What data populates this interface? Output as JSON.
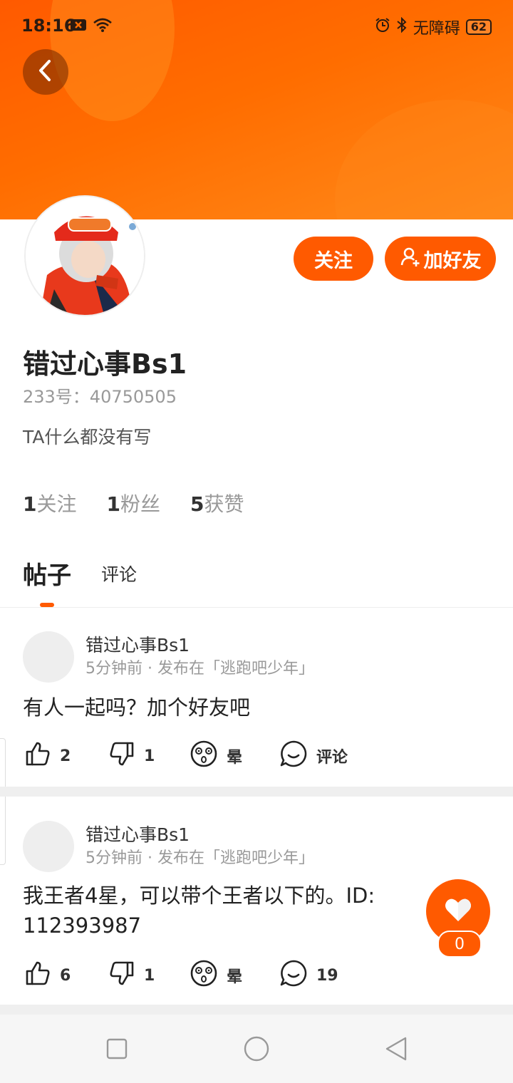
{
  "status_bar": {
    "time": "18:16",
    "accessibility": "无障碍",
    "battery": "62",
    "icons": [
      "notification-x-icon",
      "wifi-icon",
      "alarm-icon",
      "bluetooth-icon"
    ]
  },
  "header": {
    "back_icon": "chevron-left-icon"
  },
  "profile": {
    "username": "错过心事Bs1",
    "id_label": "233号：40750505",
    "bio": "TA什么都没有写",
    "follow_button": "关注",
    "add_friend_button": "加好友",
    "stats": [
      {
        "num": "1",
        "label": "关注"
      },
      {
        "num": "1",
        "label": "粉丝"
      },
      {
        "num": "5",
        "label": "获赞"
      }
    ]
  },
  "tabs": [
    {
      "label": "帖子",
      "active": true
    },
    {
      "label": "评论",
      "active": false
    }
  ],
  "posts": [
    {
      "author": "错过心事Bs1",
      "meta": "5分钟前 · 发布在「逃跑吧少年」",
      "content": "有人一起吗？加个好友吧",
      "likes": "2",
      "dislikes": "1",
      "dizzy": "晕",
      "comments": "评论"
    },
    {
      "author": "错过心事Bs1",
      "meta": "5分钟前 · 发布在「逃跑吧少年」",
      "content": "我王者4星，可以带个王者以下的。ID: 112393987",
      "likes": "6",
      "dislikes": "1",
      "dizzy": "晕",
      "comments": "19"
    }
  ],
  "fab": {
    "count": "0",
    "icon": "heart-icon"
  },
  "colors": {
    "accent": "#ff5a00",
    "banner_light": "#ff8a1a"
  },
  "nav": {
    "icons": [
      "recent-apps-icon",
      "home-icon",
      "back-triangle-icon"
    ]
  }
}
